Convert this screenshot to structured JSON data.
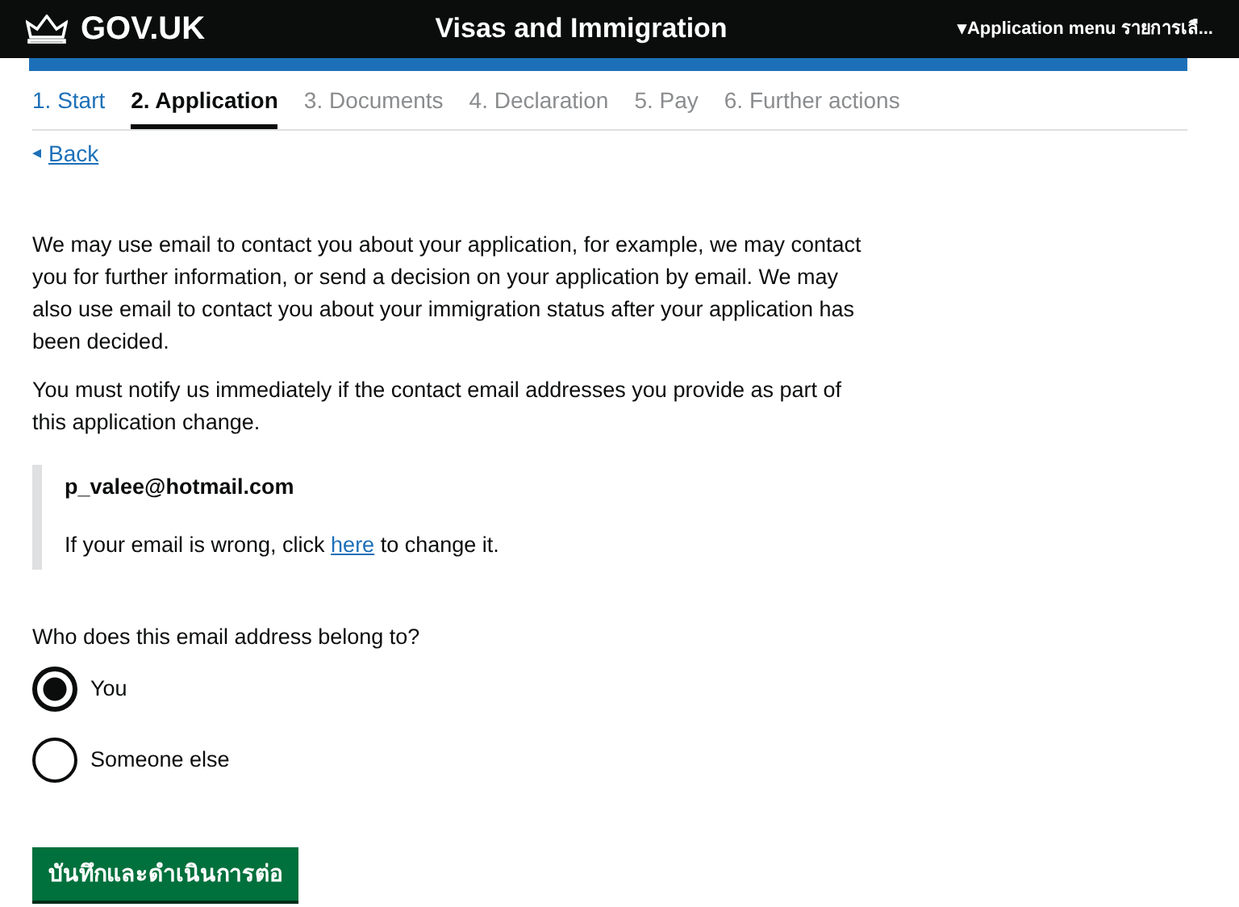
{
  "header": {
    "logo": "GOV.UK",
    "title": "Visas and Immigration",
    "menu": "Application menu รายการเลื...",
    "menu_caret": "▾"
  },
  "steps": [
    {
      "label": "1. Start",
      "selected": false,
      "disabled": false
    },
    {
      "label": "2. Application",
      "selected": true,
      "disabled": false
    },
    {
      "label": "3. Documents",
      "selected": false,
      "disabled": true
    },
    {
      "label": "4. Declaration",
      "selected": false,
      "disabled": true
    },
    {
      "label": "5. Pay",
      "selected": false,
      "disabled": true
    },
    {
      "label": "6. Further actions",
      "selected": false,
      "disabled": true
    }
  ],
  "back": {
    "icon": "◂",
    "label": "Back"
  },
  "paragraphs": [
    "We may use email to contact you about your application, for example, we may contact you for further information, or send a decision on your application by email. We may also use email to contact you about your immigration status after your application has been decided.",
    "You must notify us immediately if the contact email addresses you provide as part of this application change."
  ],
  "inset": {
    "email": "p_valee@hotmail.com",
    "note_before": "If your email is wrong, click",
    "note_link": "here",
    "note_after": "to change it."
  },
  "question": "Who does this email address belong to?",
  "options": [
    {
      "label": "You",
      "selected": true
    },
    {
      "label": "Someone else",
      "selected": false
    }
  ],
  "submit": "บันทึกและดำเนินการต่อ"
}
